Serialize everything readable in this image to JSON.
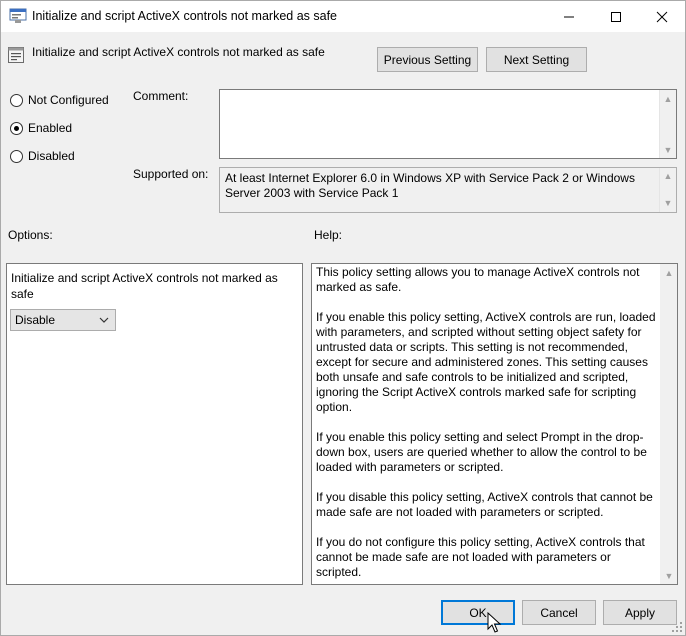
{
  "window": {
    "title": "Initialize and script ActiveX controls not marked as safe"
  },
  "header": {
    "title": "Initialize and script ActiveX controls not marked as safe",
    "previous_label": "Previous Setting",
    "next_label": "Next Setting"
  },
  "state": {
    "options": [
      "Not Configured",
      "Enabled",
      "Disabled"
    ],
    "selected": "Enabled"
  },
  "comment": {
    "label": "Comment:",
    "value": ""
  },
  "supported": {
    "label": "Supported on:",
    "value": "At least Internet Explorer 6.0 in Windows XP with Service Pack 2 or Windows Server 2003 with Service Pack 1"
  },
  "options_section": {
    "label": "Options:",
    "setting_label": "Initialize and script ActiveX controls not marked as safe",
    "dropdown_value": "Disable"
  },
  "help_section": {
    "label": "Help:",
    "paragraphs": [
      "This policy setting allows you to manage ActiveX controls not marked as safe.",
      "If you enable this policy setting, ActiveX controls are run, loaded with parameters, and scripted without setting object safety for untrusted data or scripts. This setting is not recommended, except for secure and administered zones. This setting causes both unsafe and safe controls to be initialized and scripted, ignoring the Script ActiveX controls marked safe for scripting option.",
      "If you enable this policy setting and select Prompt in the drop-down box, users are queried whether to allow the control to be loaded with parameters or scripted.",
      "If you disable this policy setting, ActiveX controls that cannot be made safe are not loaded with parameters or scripted.",
      "If you do not configure this policy setting, ActiveX controls that cannot be made safe are not loaded with parameters or scripted."
    ]
  },
  "footer": {
    "ok_label": "OK",
    "cancel_label": "Cancel",
    "apply_label": "Apply"
  },
  "icons": {
    "window": "policy-window-icon",
    "header": "policy-setting-icon",
    "minimize": "minimize-icon",
    "maximize": "maximize-icon",
    "close": "close-icon",
    "dropdown": "chevron-down-icon",
    "cursor": "mouse-cursor-icon",
    "grip": "resize-grip-icon"
  },
  "colors": {
    "accent": "#0078d7",
    "window_bg": "#f0f0f0",
    "field_bg": "#ffffff"
  }
}
